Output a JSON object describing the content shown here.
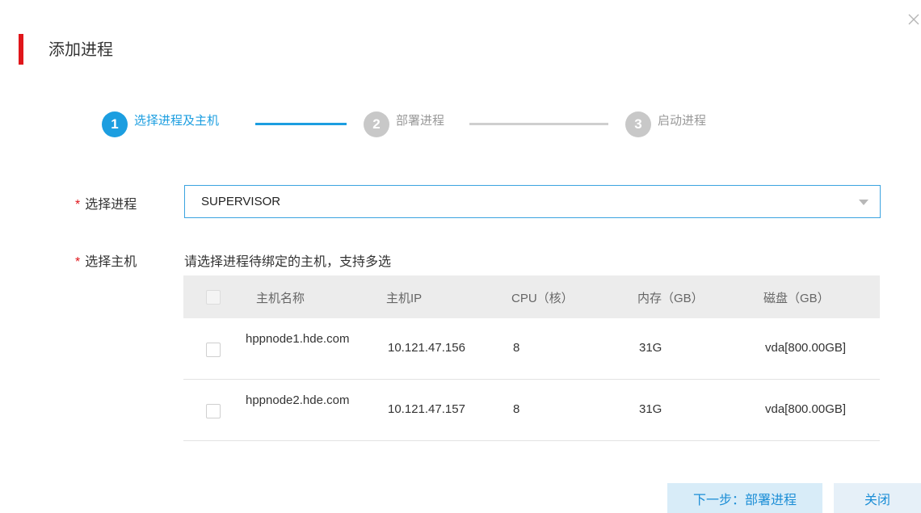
{
  "dialog": {
    "title": "添加进程",
    "close_icon": "close-icon",
    "accent_color": "#e0161b",
    "primary_color": "#1c9ee0"
  },
  "stepper": {
    "steps": [
      {
        "number": "1",
        "label": "选择进程及主机",
        "state": "active"
      },
      {
        "number": "2",
        "label": "部署进程",
        "state": "todo"
      },
      {
        "number": "3",
        "label": "启动进程",
        "state": "todo"
      }
    ]
  },
  "form": {
    "process_label": "选择进程",
    "process_value": "SUPERVISOR",
    "host_label": "选择主机",
    "host_hint": "请选择进程待绑定的主机，支持多选",
    "required_mark": "*"
  },
  "table": {
    "headers": [
      "主机名称",
      "主机IP",
      "CPU（核）",
      "内存（GB）",
      "磁盘（GB）"
    ],
    "rows": [
      {
        "name": "hppnode1.hde.com",
        "ip": "10.121.47.156",
        "cpu": "8",
        "memory": "31G",
        "disk": "vda[800.00GB]",
        "checked": false
      },
      {
        "name": "hppnode2.hde.com",
        "ip": "10.121.47.157",
        "cpu": "8",
        "memory": "31G",
        "disk": "vda[800.00GB]",
        "checked": false
      }
    ]
  },
  "footer": {
    "next_label": "下一步：部署进程",
    "close_label": "关闭"
  }
}
